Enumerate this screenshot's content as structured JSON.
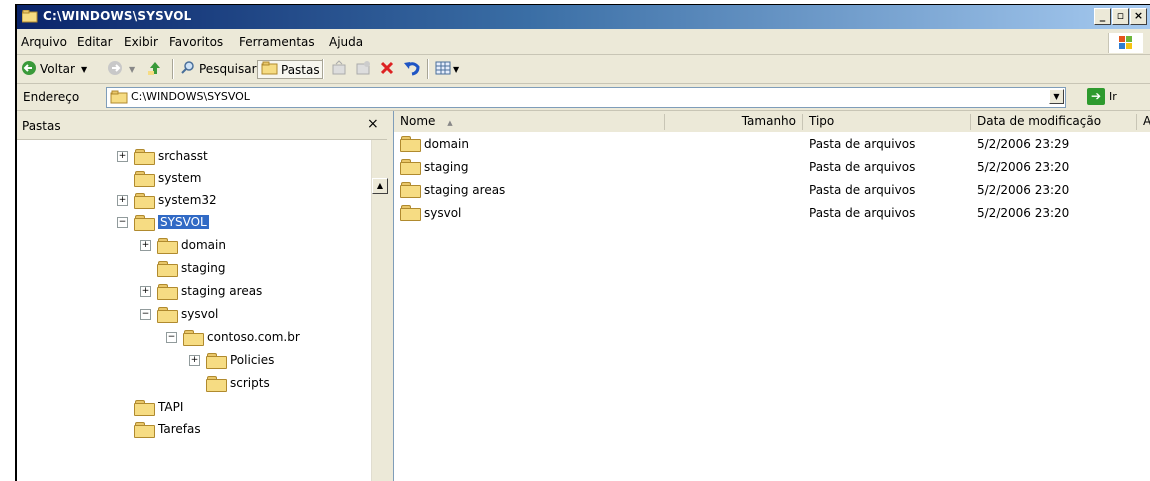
{
  "window": {
    "title": "C:\\WINDOWS\\SYSVOL"
  },
  "menu": [
    {
      "label": "Arquivo"
    },
    {
      "label": "Editar"
    },
    {
      "label": "Exibir"
    },
    {
      "label": "Favoritos"
    },
    {
      "label": "Ferramentas"
    },
    {
      "label": "Ajuda"
    }
  ],
  "toolbar": {
    "back": "Voltar",
    "search": "Pesquisar",
    "folders": "Pastas"
  },
  "address": {
    "label": "Endereço",
    "value": "C:\\WINDOWS\\SYSVOL",
    "go": "Ir"
  },
  "folders_pane": {
    "title": "Pastas",
    "close": "×",
    "tree": [
      {
        "label": "srchasst",
        "expander": "+"
      },
      {
        "label": "system",
        "expander": ""
      },
      {
        "label": "system32",
        "expander": "+"
      },
      {
        "label": "SYSVOL",
        "expander": "−",
        "selected": true
      },
      {
        "label": "domain",
        "expander": "+"
      },
      {
        "label": "staging",
        "expander": ""
      },
      {
        "label": "staging areas",
        "expander": "+"
      },
      {
        "label": "sysvol",
        "expander": "−"
      },
      {
        "label": "contoso.com.br",
        "expander": "−"
      },
      {
        "label": "Policies",
        "expander": "+"
      },
      {
        "label": "scripts",
        "expander": ""
      },
      {
        "label": "TAPI",
        "expander": ""
      },
      {
        "label": "Tarefas",
        "expander": ""
      }
    ]
  },
  "list": {
    "columns": [
      "Nome",
      "Tamanho",
      "Tipo",
      "Data de modificação",
      "At"
    ],
    "sort_indicator": "▲",
    "rows": [
      {
        "name": "domain",
        "size": "",
        "type": "Pasta de arquivos",
        "modified": "5/2/2006 23:29"
      },
      {
        "name": "staging",
        "size": "",
        "type": "Pasta de arquivos",
        "modified": "5/2/2006 23:20"
      },
      {
        "name": "staging areas",
        "size": "",
        "type": "Pasta de arquivos",
        "modified": "5/2/2006 23:20"
      },
      {
        "name": "sysvol",
        "size": "",
        "type": "Pasta de arquivos",
        "modified": "5/2/2006 23:20"
      }
    ]
  }
}
